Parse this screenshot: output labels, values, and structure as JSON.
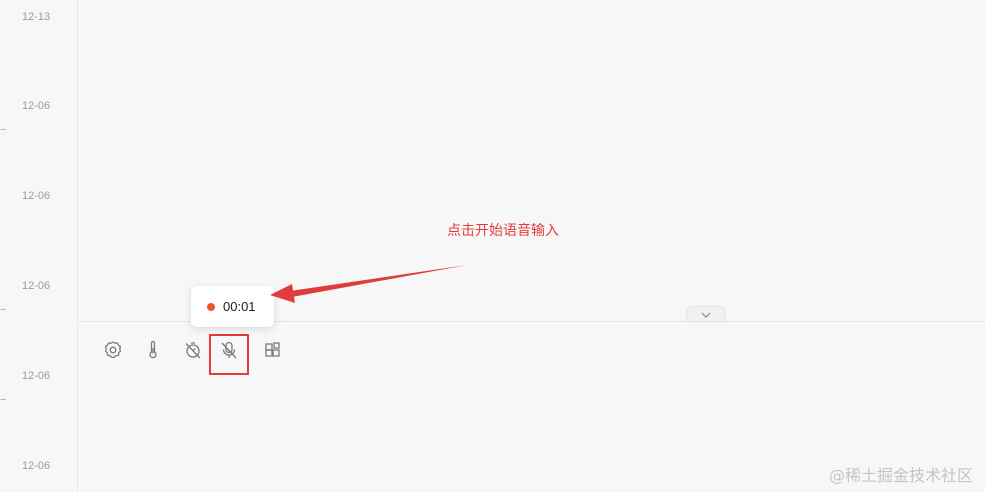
{
  "sidebar": {
    "dates": [
      "12-13",
      "12-06",
      "12-06",
      "12-06",
      "12-06",
      "12-06"
    ],
    "overflow_marker": "..."
  },
  "toolbar": {
    "icons": [
      "settings-icon",
      "thermometer-icon",
      "timer-off-icon",
      "mic-off-icon",
      "widgets-icon"
    ]
  },
  "recording": {
    "time": "00:01",
    "indicator_color": "#e8572f"
  },
  "annotation": {
    "text": "点击开始语音输入",
    "color": "#e03c3c"
  },
  "watermark": "@稀土掘金技术社区"
}
